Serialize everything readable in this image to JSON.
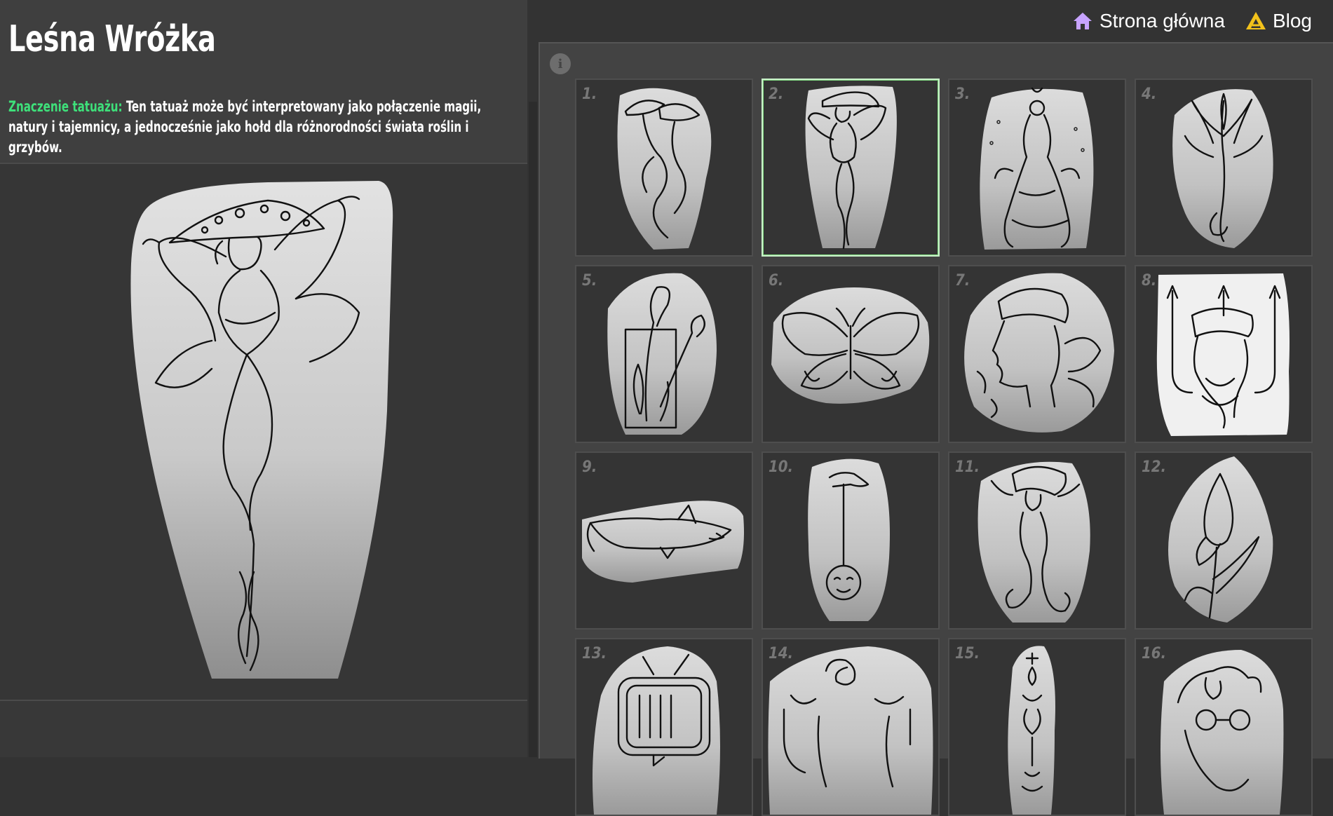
{
  "nav": {
    "home_label": "Strona główna",
    "blog_label": "Blog",
    "home_icon": "home-icon",
    "blog_icon": "blog-logo-icon",
    "home_icon_color": "#c7a3ff",
    "blog_icon_color": "#f3c21b"
  },
  "tattoo": {
    "title": "Leśna Wróżka",
    "meaning_label": "Znaczenie tatuażu:",
    "meaning_text": "Ten tatuaż może być interpretowany jako połączenie magii, natury i tajemnicy, a jednocześnie jako hołd dla różnorodności świata roślin i grzybów."
  },
  "colors": {
    "accent_green": "#3ee07a",
    "selected_border": "#c9f0c9",
    "background": "#333333"
  },
  "gallery": {
    "selected_index": 2,
    "items": [
      {
        "number": "1.",
        "subject": "mushroom-smoke"
      },
      {
        "number": "2.",
        "subject": "forest-fairy"
      },
      {
        "number": "3.",
        "subject": "moon-goddess"
      },
      {
        "number": "4.",
        "subject": "lily-flower"
      },
      {
        "number": "5.",
        "subject": "calla-lily-frame"
      },
      {
        "number": "6.",
        "subject": "butterfly"
      },
      {
        "number": "7.",
        "subject": "greek-head-flowers"
      },
      {
        "number": "8.",
        "subject": "poseidon-trident"
      },
      {
        "number": "9.",
        "subject": "shark"
      },
      {
        "number": "10.",
        "subject": "hand-moon-pendulum"
      },
      {
        "number": "11.",
        "subject": "mermaid"
      },
      {
        "number": "12.",
        "subject": "tulip"
      },
      {
        "number": "13.",
        "subject": "retro-tv"
      },
      {
        "number": "14.",
        "subject": "faces-spiral"
      },
      {
        "number": "15.",
        "subject": "ornament"
      },
      {
        "number": "16.",
        "subject": "face-glasses"
      }
    ]
  }
}
